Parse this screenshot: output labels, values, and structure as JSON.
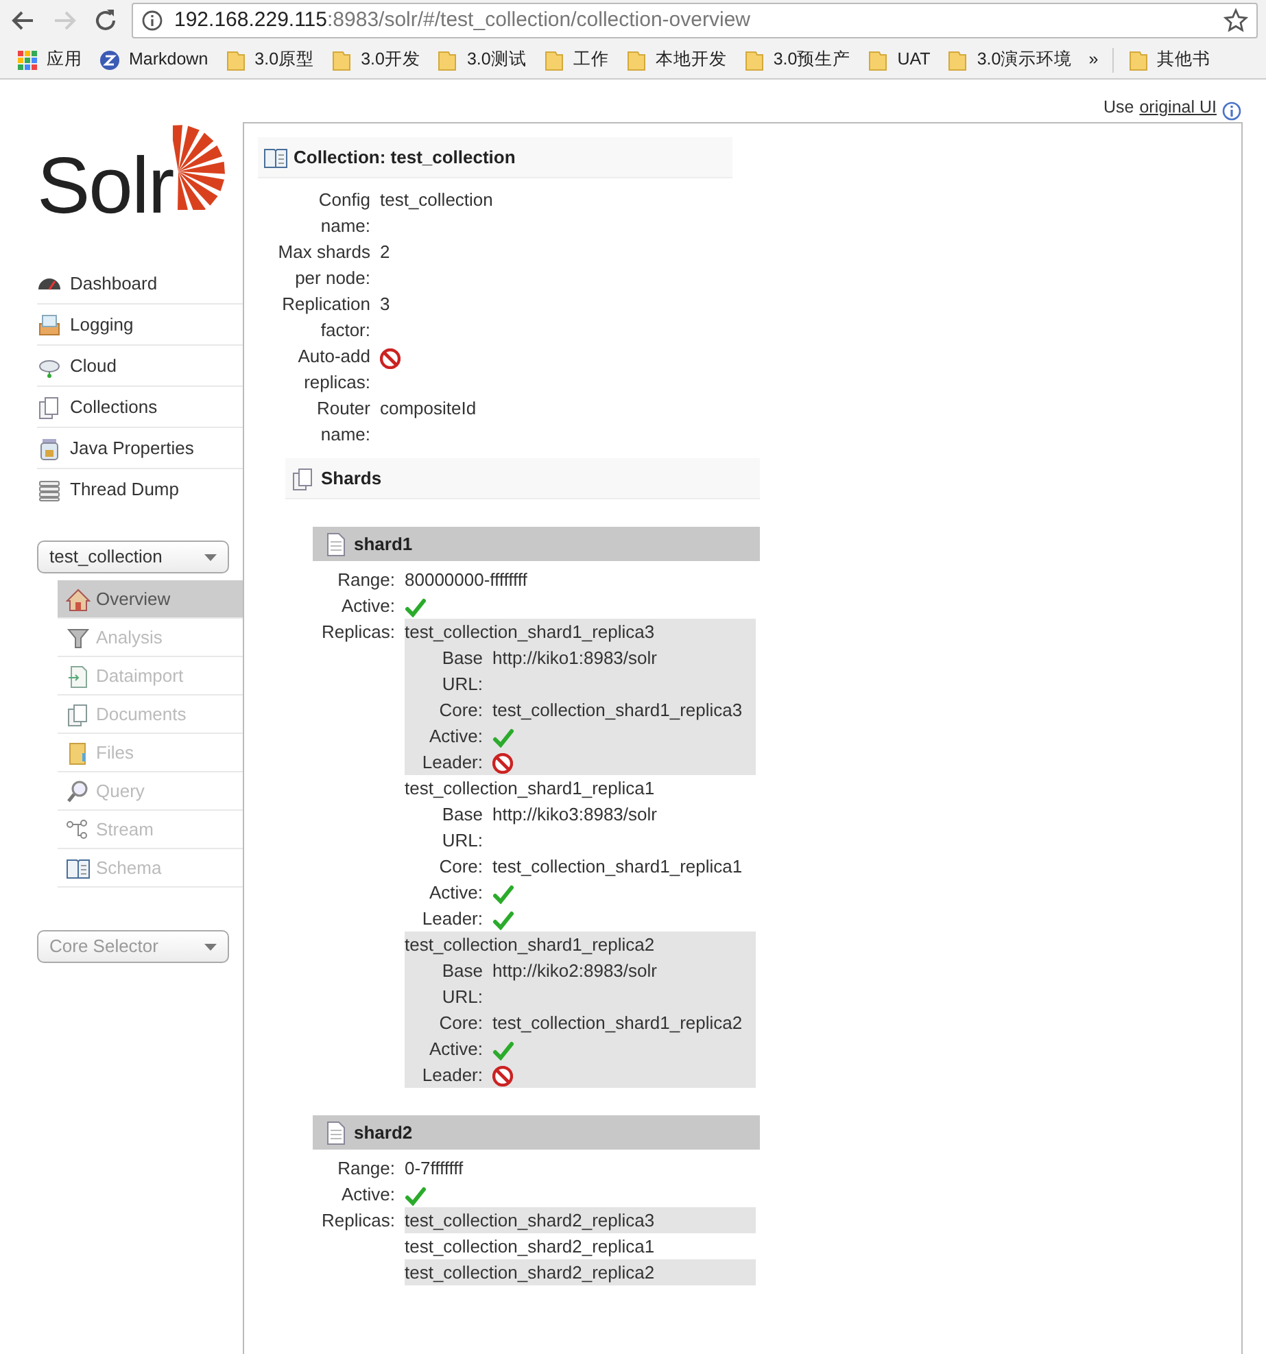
{
  "browser": {
    "back_enabled": true,
    "forward_enabled": false,
    "url_host": "192.168.229.115",
    "url_rest": ":8983/solr/#/test_collection/collection-overview",
    "bookmarks": [
      {
        "label": "应用",
        "kind": "apps"
      },
      {
        "label": "Markdown",
        "kind": "site"
      },
      {
        "label": "3.0原型",
        "kind": "folder"
      },
      {
        "label": "3.0开发",
        "kind": "folder"
      },
      {
        "label": "3.0测试",
        "kind": "folder"
      },
      {
        "label": "工作",
        "kind": "folder"
      },
      {
        "label": "本地开发",
        "kind": "folder"
      },
      {
        "label": "3.0预生产",
        "kind": "folder"
      },
      {
        "label": "UAT",
        "kind": "folder"
      },
      {
        "label": "3.0演示环境",
        "kind": "folder"
      }
    ],
    "overflow": "»",
    "other_bookmarks": {
      "label": "其他书",
      "kind": "folder"
    }
  },
  "header": {
    "prefix": "Use",
    "link": "original UI"
  },
  "logo_text": "Solr",
  "main_menu": [
    {
      "label": "Dashboard",
      "kind": "dashboard"
    },
    {
      "label": "Logging",
      "kind": "logging"
    },
    {
      "label": "Cloud",
      "kind": "cloud"
    },
    {
      "label": "Collections",
      "kind": "collections"
    },
    {
      "label": "Java Properties",
      "kind": "java"
    },
    {
      "label": "Thread Dump",
      "kind": "threads"
    }
  ],
  "collection_select": "test_collection",
  "core_menu": [
    {
      "label": "Overview",
      "kind": "overview",
      "selected": true
    },
    {
      "label": "Analysis",
      "kind": "analysis",
      "selected": false
    },
    {
      "label": "Dataimport",
      "kind": "dataimport",
      "selected": false
    },
    {
      "label": "Documents",
      "kind": "documents",
      "selected": false
    },
    {
      "label": "Files",
      "kind": "files",
      "selected": false
    },
    {
      "label": "Query",
      "kind": "query",
      "selected": false
    },
    {
      "label": "Stream",
      "kind": "stream",
      "selected": false
    },
    {
      "label": "Schema",
      "kind": "schema",
      "selected": false
    }
  ],
  "core_selector": {
    "placeholder": "Core Selector"
  },
  "collection": {
    "title": "Collection: test_collection",
    "properties": [
      {
        "label": "Config name:",
        "kind": "text",
        "value": "test_collection"
      },
      {
        "label": "Max shards per node:",
        "kind": "text",
        "value": "2"
      },
      {
        "label": "Replication factor:",
        "kind": "text",
        "value": "3"
      },
      {
        "label": "Auto-add replicas:",
        "kind": "flag",
        "checked": false
      },
      {
        "label": "Router name:",
        "kind": "text",
        "value": "compositeId"
      }
    ]
  },
  "shards_title": "Shards",
  "shards": [
    {
      "name": "shard1",
      "fields": [
        {
          "label": "Range:",
          "kind": "text",
          "value": "80000000-ffffffff"
        },
        {
          "label": "Active:",
          "kind": "flag",
          "checked": true
        }
      ],
      "replicas_label": "Replicas:",
      "replicas": [
        {
          "name": "test_collection_shard1_replica3",
          "fields": [
            {
              "label": "Base URL:",
              "kind": "text",
              "value": "http://kiko1:8983/solr"
            },
            {
              "label": "Core:",
              "kind": "text",
              "value": "test_collection_shard1_replica3"
            },
            {
              "label": "Active:",
              "kind": "flag",
              "checked": true
            },
            {
              "label": "Leader:",
              "kind": "flag",
              "checked": false
            }
          ]
        },
        {
          "name": "test_collection_shard1_replica1",
          "fields": [
            {
              "label": "Base URL:",
              "kind": "text",
              "value": "http://kiko3:8983/solr"
            },
            {
              "label": "Core:",
              "kind": "text",
              "value": "test_collection_shard1_replica1"
            },
            {
              "label": "Active:",
              "kind": "flag",
              "checked": true
            },
            {
              "label": "Leader:",
              "kind": "flag",
              "checked": true
            }
          ]
        },
        {
          "name": "test_collection_shard1_replica2",
          "fields": [
            {
              "label": "Base URL:",
              "kind": "text",
              "value": "http://kiko2:8983/solr"
            },
            {
              "label": "Core:",
              "kind": "text",
              "value": "test_collection_shard1_replica2"
            },
            {
              "label": "Active:",
              "kind": "flag",
              "checked": true
            },
            {
              "label": "Leader:",
              "kind": "flag",
              "checked": false
            }
          ]
        }
      ]
    },
    {
      "name": "shard2",
      "fields": [
        {
          "label": "Range:",
          "kind": "text",
          "value": "0-7fffffff"
        },
        {
          "label": "Active:",
          "kind": "flag",
          "checked": true
        }
      ],
      "replicas_label": "Replicas:",
      "replicas": [
        {
          "name": "test_collection_shard2_replica3"
        },
        {
          "name": "test_collection_shard2_replica1"
        },
        {
          "name": "test_collection_shard2_replica2"
        }
      ]
    }
  ]
}
